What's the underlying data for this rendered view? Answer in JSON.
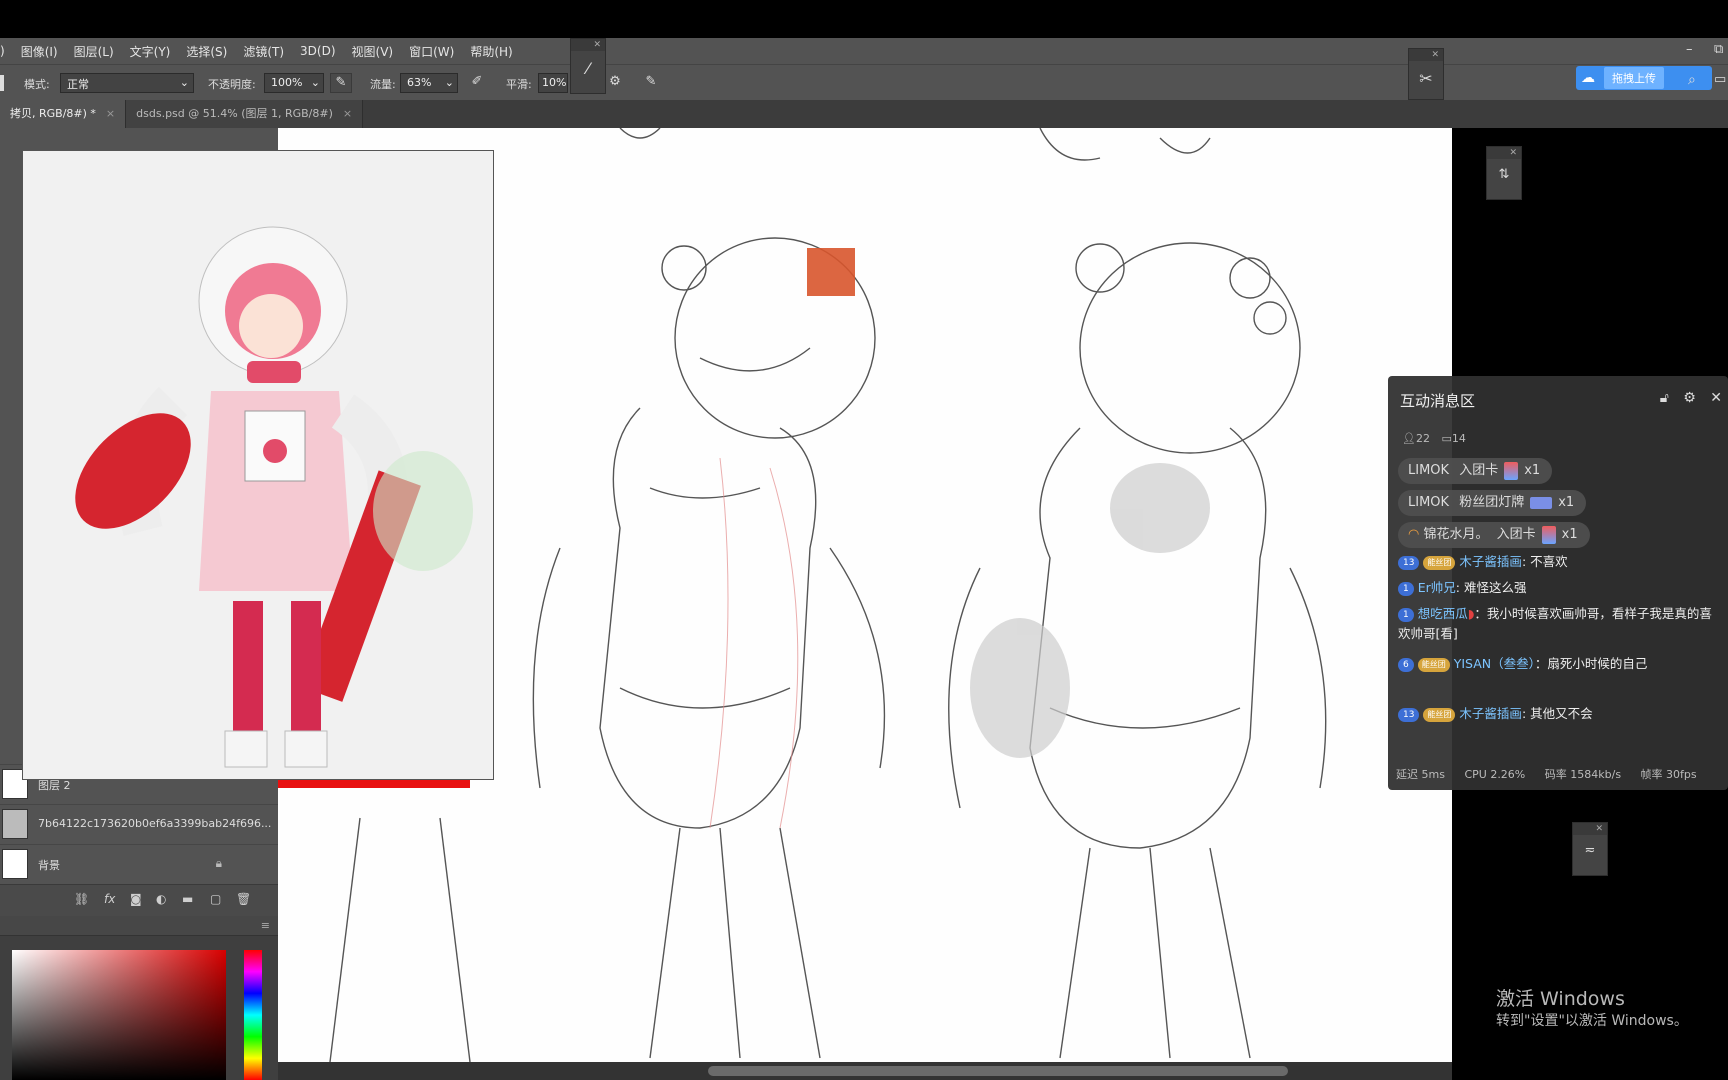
{
  "menu": {
    "items": [
      "图像(I)",
      "图层(L)",
      "文字(Y)",
      "选择(S)",
      "滤镜(T)",
      "3D(D)",
      "视图(V)",
      "窗口(W)",
      "帮助(H)"
    ]
  },
  "options": {
    "mode_label": "模式:",
    "mode_value": "正常",
    "opacity_label": "不透明度:",
    "opacity_value": "100%",
    "flow_label": "流量:",
    "flow_value": "63%",
    "smooth_label": "平滑:",
    "smooth_value": "10%",
    "upload_label": "拖拽上传"
  },
  "tabs": [
    {
      "label": "拷贝, RGB/8#) *",
      "close": "×"
    },
    {
      "label": "dsds.psd @ 51.4% (图层 1, RGB/8#)",
      "close": "×"
    }
  ],
  "layers": {
    "items": [
      {
        "name": "图层 2"
      },
      {
        "name": "7b64122c173620b0ef6a3399bab24f696..."
      },
      {
        "name": "背景"
      }
    ],
    "footer_icons": [
      "link-icon",
      "fx-icon",
      "mask-icon",
      "adjust-icon",
      "folder-icon",
      "new-layer-icon",
      "trash-icon"
    ],
    "fx_label": "fx"
  },
  "chat": {
    "title": "互动消息区",
    "viewers": "22",
    "messages_count": "14",
    "gifts": [
      {
        "user": "LIMOK",
        "item": "入团卡",
        "count": "x1"
      },
      {
        "user": "LIMOK",
        "item": "粉丝团灯牌",
        "count": "x1"
      },
      {
        "user": "锦花水月。",
        "item": "入团卡",
        "count": "x1"
      }
    ],
    "messages": [
      {
        "level": "13",
        "badge": "能丝团",
        "user": "木子酱插画",
        "text": "不喜欢"
      },
      {
        "level": "1",
        "badge": "",
        "user": "Er帅兄",
        "text": "难怪这么强"
      },
      {
        "level": "1",
        "badge": "",
        "user": "想吃西瓜",
        "text": "我小时候喜欢画帅哥，看样子我是真的喜欢帅哥[看]"
      },
      {
        "level": "6",
        "badge": "能丝团",
        "user": "YISAN（叁叁）",
        "text": "扇死小时候的自己"
      },
      {
        "level": "13",
        "badge": "能丝团",
        "user": "木子酱插画",
        "text": "其他又不会"
      }
    ],
    "footer": {
      "latency": "延迟 5ms",
      "cpu": "CPU 2.26%",
      "bitrate": "码率 1584kb/s",
      "fps": "帧率 30fps"
    }
  },
  "watermark": {
    "line1": "激活 Windows",
    "line2": "转到\"设置\"以激活 Windows。"
  },
  "colors": {
    "ps_panel": "#535353",
    "chat_bg": "#303030",
    "accent_blue": "#3d8ff0",
    "hue_red": "#d80000"
  }
}
